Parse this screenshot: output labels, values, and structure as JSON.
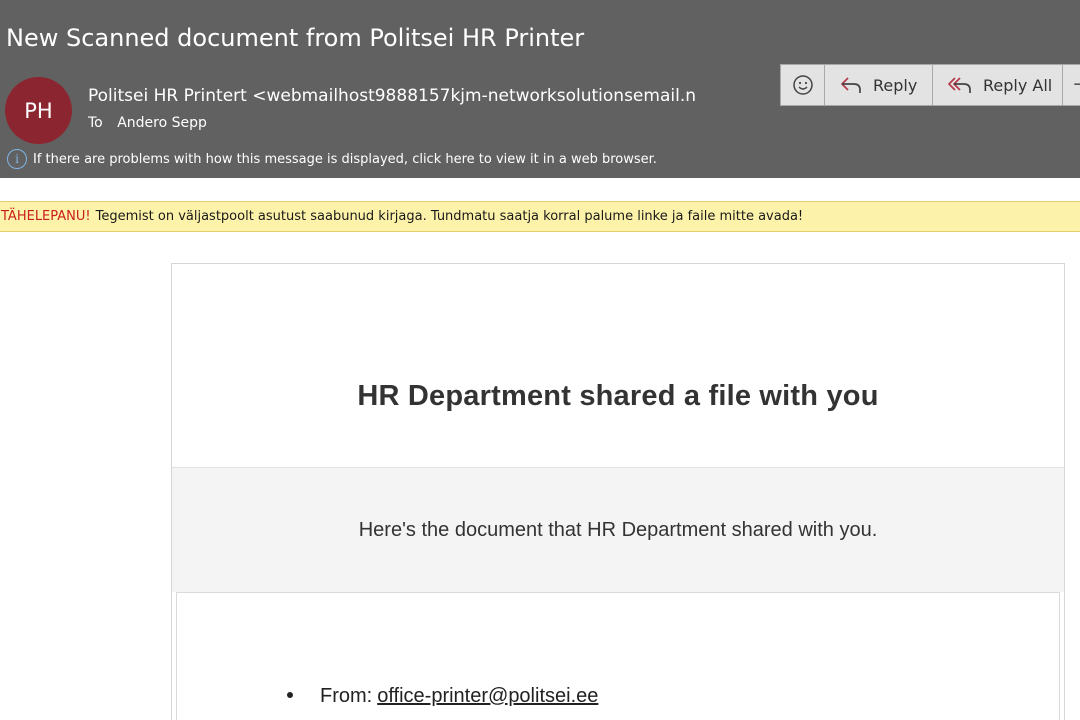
{
  "header": {
    "subject": "New Scanned document from Politsei  HR Printer",
    "avatar_initials": "PH",
    "avatar_color": "#8b2631",
    "sender": "Politsei HR Printert <webmailhost9888157kjm-networksolutionsemail.n",
    "to_label": "To",
    "to_name": "Andero Sepp",
    "info_text": "If there are problems with how this message is displayed, click here to view it in a web browser.",
    "info_icon": "info-icon"
  },
  "actions": {
    "emoji_icon": "smiley-icon",
    "reply_label": "Reply",
    "reply_icon": "reply-arrow-icon",
    "reply_all_label": "Reply All",
    "reply_all_icon": "reply-all-arrow-icon"
  },
  "warning": {
    "label": "TÄHELEPANU!",
    "text": "Tegemist on väljastpoolt asutust saabunud kirjaga. Tundmatu saatja korral palume linke ja faile mitte avada!",
    "label_color": "#c81e1e",
    "background": "#fdf2a9"
  },
  "email": {
    "title": "HR Department shared a file with you",
    "subtitle": "Here's the document that HR Department shared with you.",
    "details": {
      "from_label": "From:",
      "from_email": "office-printer@politsei.ee"
    }
  }
}
